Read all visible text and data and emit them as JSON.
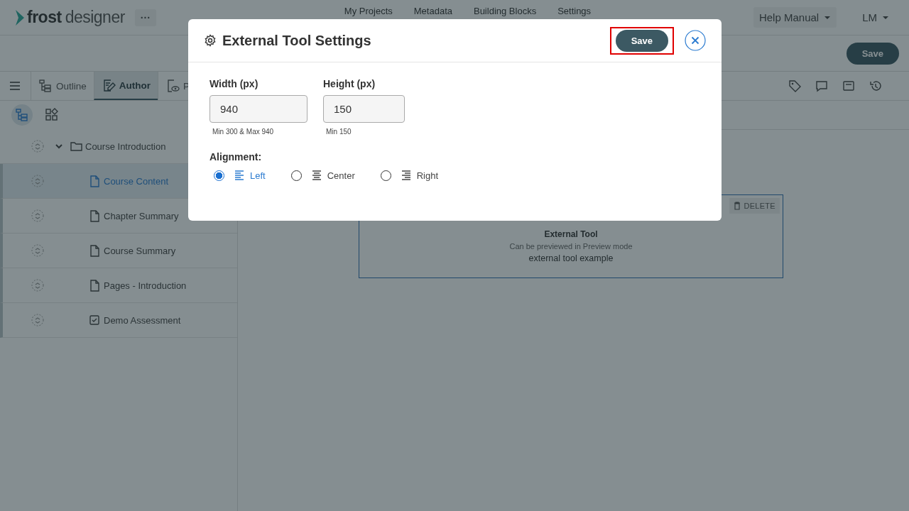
{
  "header": {
    "logo_bold": "frost",
    "logo_light": "designer",
    "more_button": "···",
    "nav": [
      "My Projects",
      "Metadata",
      "Building Blocks",
      "Settings"
    ],
    "help_menu": "Help Manual",
    "user_menu": "LM"
  },
  "toolbar": {
    "save_button": "Save"
  },
  "tabs": [
    {
      "label": "Outline",
      "selected": false
    },
    {
      "label": "Author",
      "selected": true
    },
    {
      "label": "P",
      "selected": false
    }
  ],
  "sidebar": {
    "views": [
      {
        "selected": true
      },
      {
        "selected": false
      }
    ],
    "tree": [
      {
        "label": "Course Introduction",
        "kind": "folder",
        "expanded": true,
        "selected": false,
        "children": [
          {
            "label": "Course Content",
            "kind": "page",
            "selected": true
          },
          {
            "label": "Chapter Summary",
            "kind": "page",
            "selected": false
          },
          {
            "label": "Course Summary",
            "kind": "page",
            "selected": false
          },
          {
            "label": "Pages - Introduction",
            "kind": "page",
            "selected": false
          },
          {
            "label": "Demo Assessment",
            "kind": "assessment",
            "selected": false
          }
        ]
      }
    ]
  },
  "content": {
    "delete_button": "DELETE",
    "block_title": "External Tool",
    "block_hint": "Can be previewed in Preview mode",
    "block_text": "external tool example"
  },
  "dialog": {
    "title": "External Tool Settings",
    "save_button": "Save",
    "save_highlighted": true,
    "fields": [
      {
        "label": "Width (px)",
        "value": "940",
        "hint": "Min 300 & Max 940"
      },
      {
        "label": "Height (px)",
        "value": "150",
        "hint": "Min 150"
      }
    ],
    "alignment_label": "Alignment:",
    "alignment_options": [
      {
        "label": "Left",
        "selected": true
      },
      {
        "label": "Center",
        "selected": false
      },
      {
        "label": "Right",
        "selected": false
      }
    ]
  }
}
